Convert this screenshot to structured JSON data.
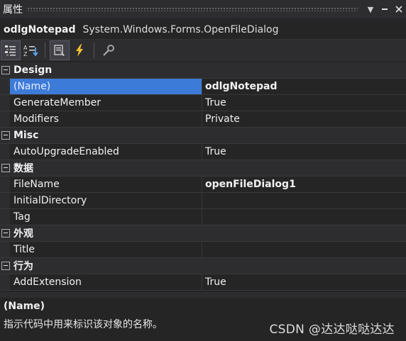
{
  "window": {
    "title": "属性"
  },
  "object": {
    "name": "odlgNotepad",
    "type": "System.Windows.Forms.OpenFileDialog"
  },
  "toolbar": {
    "icons": [
      "categorized-icon",
      "alphabetical-icon",
      "properties-icon",
      "events-icon",
      "property-pages-icon"
    ]
  },
  "categories": [
    {
      "name": "Design",
      "props": [
        {
          "name": "(Name)",
          "value": "odlgNotepad"
        },
        {
          "name": "GenerateMember",
          "value": "True"
        },
        {
          "name": "Modifiers",
          "value": "Private"
        }
      ]
    },
    {
      "name": "Misc",
      "props": [
        {
          "name": "AutoUpgradeEnabled",
          "value": "True"
        }
      ]
    },
    {
      "name": "数据",
      "props": [
        {
          "name": "FileName",
          "value": "openFileDialog1"
        },
        {
          "name": "InitialDirectory",
          "value": ""
        },
        {
          "name": "Tag",
          "value": ""
        }
      ]
    },
    {
      "name": "外观",
      "props": [
        {
          "name": "Title",
          "value": ""
        }
      ]
    },
    {
      "name": "行为",
      "props": [
        {
          "name": "AddExtension",
          "value": "True"
        }
      ]
    }
  ],
  "description": {
    "title": "(Name)",
    "text": "指示代码中用来标识该对象的名称。"
  },
  "watermark": "CSDN @达达哒哒达达",
  "colors": {
    "selection": "#3d7bd9",
    "background": "#252526",
    "accent_events": "#f0c030"
  }
}
